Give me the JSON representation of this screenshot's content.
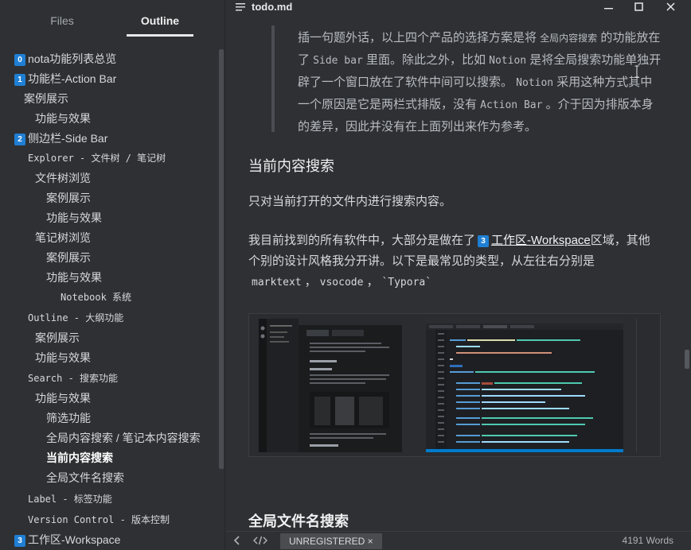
{
  "sidebar": {
    "tabs": [
      {
        "label": "Files"
      },
      {
        "label": "Outline"
      }
    ],
    "outline": [
      {
        "badge": "0",
        "label": "nota功能列表总览"
      },
      {
        "badge": "1",
        "label": "功能栏-Action Bar"
      },
      {
        "label": "案例展示"
      },
      {
        "label": "功能与效果"
      },
      {
        "badge": "2",
        "label": "侧边栏-Side Bar"
      },
      {
        "label": "Explorer - 文件树 / 笔记树"
      },
      {
        "label": "文件树浏览"
      },
      {
        "label": "案例展示"
      },
      {
        "label": "功能与效果"
      },
      {
        "label": "笔记树浏览"
      },
      {
        "label": "案例展示"
      },
      {
        "label": "功能与效果"
      },
      {
        "label": "Notebook 系统"
      },
      {
        "label": "Outline - 大纲功能"
      },
      {
        "label": "案例展示"
      },
      {
        "label": "功能与效果"
      },
      {
        "label": "Search - 搜索功能"
      },
      {
        "label": "功能与效果"
      },
      {
        "label": "筛选功能"
      },
      {
        "label": "全局内容搜索 / 笔记本内容搜索"
      },
      {
        "label": "当前内容搜索"
      },
      {
        "label": "全局文件名搜索"
      },
      {
        "label": "Label - 标签功能"
      },
      {
        "label": "Version Control - 版本控制"
      },
      {
        "badge": "3",
        "label": "工作区-Workspace"
      }
    ]
  },
  "titlebar": {
    "title": "todo.md"
  },
  "editor": {
    "quote": {
      "t1": "插一句题外话，以上四个产品的选择方案是将 ",
      "c1": "全局内容搜索",
      "t2": " 的功能放在了 ",
      "c2": "Side bar",
      "t3": " 里面。除此之外，比如 ",
      "c3": "Notion",
      "t4": " 是将全局搜索功能单独开辟了一个窗口放在了软件中间可以搜索。 ",
      "c4": "Notion",
      "t5": " 采用这种方式其中一个原因是它是两栏式排版，没有 ",
      "c5": "Action Bar",
      "t6": " 。介于因为排版本身的差异，因此并没有在上面列出来作为参考。"
    },
    "heading1": "当前内容搜索",
    "para1": "只对当前打开的文件内进行搜索内容。",
    "para2": {
      "t1": "我目前找到的所有软件中，大部分是做在了",
      "badge": "3",
      "link": "工作区-Workspace",
      "t2": "区域，其他个别的设计风格我分开讲。以下是最常见的类型，从左往右分别是",
      "code1": "marktext",
      "sep1": "，",
      "code2": "vsocode",
      "sep2": "，",
      "code3": "`Typora`"
    },
    "heading2": "全局文件名搜索"
  },
  "statusbar": {
    "unregistered": "UNREGISTERED ×",
    "words": "4191 Words"
  },
  "colors": {
    "background": "#2e3033",
    "badge": "#1f7fd4",
    "text": "#d6d9dc"
  }
}
